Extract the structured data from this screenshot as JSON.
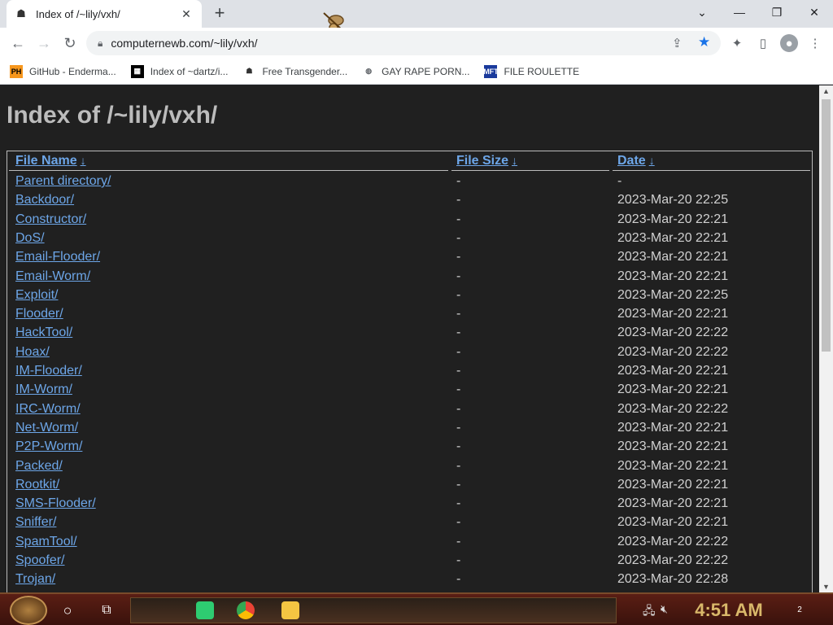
{
  "browser": {
    "tab_title": "Index of /~lily/vxh/",
    "url": "computernewb.com/~lily/vxh/",
    "tab_close": "✕",
    "new_tab": "+"
  },
  "window_controls": {
    "menu": "⌄",
    "minimize": "—",
    "restore": "❐",
    "close": "✕"
  },
  "nav": {
    "back": "←",
    "forward": "→",
    "reload": "↻",
    "lock": "🔒"
  },
  "bookmarks": [
    {
      "label": "GitHub - Enderma...",
      "icon": "PH"
    },
    {
      "label": "Index of ~dartz/i...",
      "icon": "QR"
    },
    {
      "label": "Free Transgender...",
      "icon": "ghost"
    },
    {
      "label": "GAY RAPE PORN...",
      "icon": "globe"
    },
    {
      "label": "FILE ROULETTE",
      "icon": "MFT"
    }
  ],
  "page": {
    "heading": "Index of /~lily/vxh/",
    "columns": {
      "name": "File Name",
      "size": "File Size",
      "date": "Date",
      "sort_glyph": "↓"
    },
    "rows": [
      {
        "name": "Parent directory/",
        "size": "-",
        "date": "-"
      },
      {
        "name": "Backdoor/",
        "size": "-",
        "date": "2023-Mar-20 22:25"
      },
      {
        "name": "Constructor/",
        "size": "-",
        "date": "2023-Mar-20 22:21"
      },
      {
        "name": "DoS/",
        "size": "-",
        "date": "2023-Mar-20 22:21"
      },
      {
        "name": "Email-Flooder/",
        "size": "-",
        "date": "2023-Mar-20 22:21"
      },
      {
        "name": "Email-Worm/",
        "size": "-",
        "date": "2023-Mar-20 22:21"
      },
      {
        "name": "Exploit/",
        "size": "-",
        "date": "2023-Mar-20 22:25"
      },
      {
        "name": "Flooder/",
        "size": "-",
        "date": "2023-Mar-20 22:21"
      },
      {
        "name": "HackTool/",
        "size": "-",
        "date": "2023-Mar-20 22:22"
      },
      {
        "name": "Hoax/",
        "size": "-",
        "date": "2023-Mar-20 22:22"
      },
      {
        "name": "IM-Flooder/",
        "size": "-",
        "date": "2023-Mar-20 22:21"
      },
      {
        "name": "IM-Worm/",
        "size": "-",
        "date": "2023-Mar-20 22:21"
      },
      {
        "name": "IRC-Worm/",
        "size": "-",
        "date": "2023-Mar-20 22:22"
      },
      {
        "name": "Net-Worm/",
        "size": "-",
        "date": "2023-Mar-20 22:21"
      },
      {
        "name": "P2P-Worm/",
        "size": "-",
        "date": "2023-Mar-20 22:21"
      },
      {
        "name": "Packed/",
        "size": "-",
        "date": "2023-Mar-20 22:21"
      },
      {
        "name": "Rootkit/",
        "size": "-",
        "date": "2023-Mar-20 22:21"
      },
      {
        "name": "SMS-Flooder/",
        "size": "-",
        "date": "2023-Mar-20 22:21"
      },
      {
        "name": "Sniffer/",
        "size": "-",
        "date": "2023-Mar-20 22:21"
      },
      {
        "name": "SpamTool/",
        "size": "-",
        "date": "2023-Mar-20 22:22"
      },
      {
        "name": "Spoofer/",
        "size": "-",
        "date": "2023-Mar-20 22:22"
      },
      {
        "name": "Trojan/",
        "size": "-",
        "date": "2023-Mar-20 22:28"
      }
    ]
  },
  "taskbar": {
    "clock": "4:51 AM",
    "notification_count": "2"
  },
  "colors": {
    "link": "#6da6e8",
    "page_bg": "#202020",
    "heading": "#bcbcbc",
    "clock": "#d9b86a"
  }
}
